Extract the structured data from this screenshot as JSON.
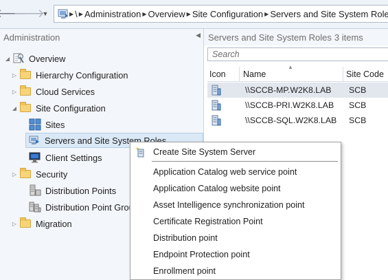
{
  "breadcrumb": {
    "root_symbol": "\\",
    "items": [
      "Administration",
      "Overview",
      "Site Configuration",
      "Servers and Site System Roles"
    ]
  },
  "nav": {
    "title": "Administration",
    "tree": [
      {
        "label": "Overview",
        "icon": "overview-icon",
        "expander": "expanded"
      },
      {
        "label": "Hierarchy Configuration",
        "icon": "folder-icon",
        "expander": "collapsed"
      },
      {
        "label": "Cloud Services",
        "icon": "folder-icon",
        "expander": "collapsed"
      },
      {
        "label": "Site Configuration",
        "icon": "folder-icon",
        "expander": "expanded"
      },
      {
        "label": "Sites",
        "icon": "sites-icon",
        "expander": "none"
      },
      {
        "label": "Servers and Site System Roles",
        "icon": "server-roles-icon",
        "expander": "none",
        "selected": true
      },
      {
        "label": "Client Settings",
        "icon": "client-settings-icon",
        "expander": "none"
      },
      {
        "label": "Security",
        "icon": "folder-icon",
        "expander": "collapsed"
      },
      {
        "label": "Distribution Points",
        "icon": "distribution-points-icon",
        "expander": "none"
      },
      {
        "label": "Distribution Point Groups",
        "icon": "distribution-point-groups-icon",
        "expander": "none"
      },
      {
        "label": "Migration",
        "icon": "folder-icon",
        "expander": "collapsed"
      }
    ]
  },
  "content": {
    "title": "Servers and Site System Roles",
    "count": "3 items",
    "search_placeholder": "Search",
    "columns": [
      "Icon",
      "Name",
      "Site Code"
    ],
    "rows": [
      {
        "name": "\\\\SCCB-MP.W2K8.LAB",
        "site_code": "SCB",
        "selected": true
      },
      {
        "name": "\\\\SCCB-PRI.W2K8.LAB",
        "site_code": "SCB",
        "selected": false
      },
      {
        "name": "\\\\SCCB-SQL.W2K8.LAB",
        "site_code": "SCB",
        "selected": false
      }
    ]
  },
  "context_menu": {
    "items": [
      {
        "label": "Create Site System Server",
        "icon": "create-server-icon"
      },
      {
        "label": "Application Catalog web service point"
      },
      {
        "label": "Application Catalog website point"
      },
      {
        "label": "Asset Intelligence synchronization point"
      },
      {
        "label": "Certificate Registration Point"
      },
      {
        "label": "Distribution point"
      },
      {
        "label": "Endpoint Protection point"
      },
      {
        "label": "Enrollment point"
      }
    ]
  },
  "colors": {
    "accent_blue": "#2f6fb6",
    "selection": "#dbe9f7",
    "folder": "#f7d478"
  }
}
